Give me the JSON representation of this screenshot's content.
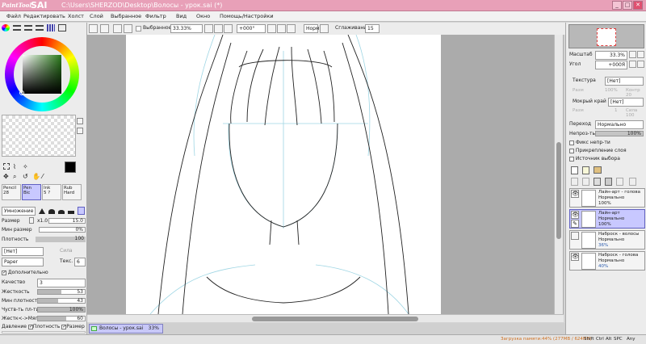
{
  "window": {
    "app_name": "SAI",
    "app_subtitle": "PaintTool",
    "title": "C:\\Users\\SHERZOD\\Desktop\\Волосы - урок.sai (*)",
    "minimize": "_",
    "maximize": "□",
    "close": "✕"
  },
  "menu": [
    "Файл",
    "Редактировать",
    "Холст",
    "Слой",
    "Выбранное",
    "Фильтр",
    "Вид",
    "Окно",
    "Помощь/Настройки"
  ],
  "toolbar": {
    "selected_label": "Выбранное",
    "zoom": "33.33%",
    "angle": "+000°",
    "mode": "Норм",
    "smoothing_label": "Сглаживание",
    "smoothing_value": "15"
  },
  "tools": {
    "brushes": [
      {
        "name": "Pencil",
        "size": "28"
      },
      {
        "name": "Pen",
        "size": "Bic"
      },
      {
        "name": "Ink",
        "size": "5 ?"
      },
      {
        "name": "Rub",
        "size": "Hard"
      }
    ],
    "blend_mode": "Умножение",
    "size_label": "Размер",
    "size_mult": "x1.0",
    "size_value": "15.0",
    "min_size_label": "Мин размер",
    "min_size_value": "0%",
    "density_label": "Плотность",
    "density_value": "100",
    "shape_value": "[Нет]",
    "shape_strength": "Сила",
    "texture_value": "Paper",
    "texture_label": "Текс.",
    "texture_num": "6",
    "extra_label": "Дополнительно",
    "quality_label": "Качество",
    "quality_value": "3",
    "hardness_label": "Жесткость",
    "hardness_value": "53",
    "min_density_label": "Мин плотность",
    "min_density_value": "43",
    "sensitivity_label": "Чуств-ть пл-ти",
    "sensitivity_value": "100%",
    "sensitivity2_label": "Жестк<->Мягк",
    "sensitivity2_value": "60",
    "pressure_label": "Давление",
    "pressure_density": "Плотность",
    "pressure_size": "Размер"
  },
  "navigator": {
    "zoom_label": "Масштаб",
    "zoom_value": "33.3%",
    "angle_label": "Угол",
    "angle_value": "+000Я"
  },
  "layer_props": {
    "texture_label": "Текстура",
    "texture_value": "[Нет]",
    "scale_label": "Разм",
    "scale_value": "100%",
    "contrast_value": "Контр 20",
    "wet_label": "Мокрый край",
    "wet_value": "[Нет]",
    "width_label": "Разм",
    "width_value": "1",
    "strength_value": "Сила 100",
    "blend_label": "Переход",
    "blend_value": "Нормально",
    "opacity_label": "Непроз-ть",
    "opacity_value": "100%",
    "protect_label": "Фикс непр-ти",
    "clip_label": "Прикрепление слоя",
    "source_label": "Источник выбора"
  },
  "layers": [
    {
      "name": "Лайн-арт - голова",
      "mode": "Нормально",
      "opacity": "100%",
      "visible": true,
      "selected": false
    },
    {
      "name": "Лайн-арт",
      "mode": "Нормально",
      "opacity": "100%",
      "visible": true,
      "selected": true
    },
    {
      "name": "Наброск - волосы",
      "mode": "Нормально",
      "opacity": "36%",
      "visible": false,
      "selected": false
    },
    {
      "name": "Наброск - голова",
      "mode": "Нормально",
      "opacity": "40%",
      "visible": true,
      "selected": false
    }
  ],
  "document_tab": {
    "name": "Волосы - урок.sai",
    "zoom": "33%"
  },
  "status": {
    "memory": "Загрузка памяти:44% (277MB / 624MB)",
    "keys": [
      "Shift",
      "Ctrl",
      "Alt",
      "SPC",
      "Any"
    ]
  },
  "colors": {
    "title_bg": "#e8a0b8",
    "primary": "#000000",
    "secondary": "#3fb7cf",
    "layer_selected": "#c8c8ff"
  }
}
